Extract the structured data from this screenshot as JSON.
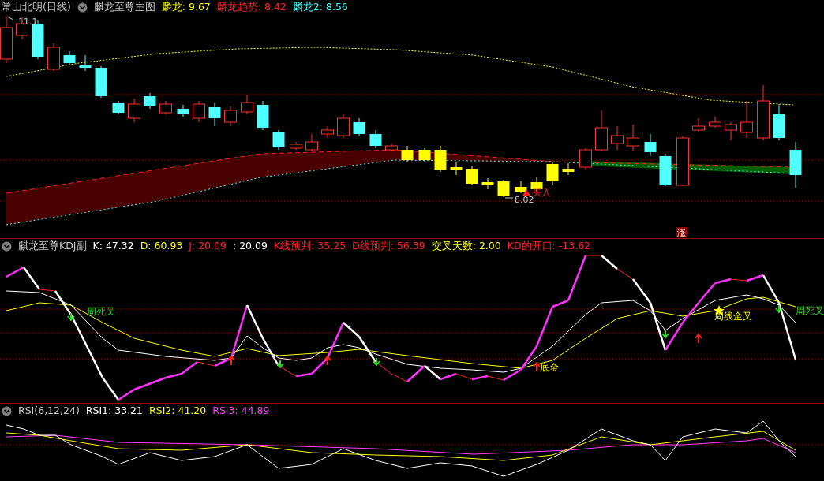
{
  "main_panel": {
    "stock_name": "常山北明(日线)",
    "indicator": "麒龙至尊主图",
    "readouts": [
      {
        "text": "麟龙: 9.67",
        "color": "#ffff00"
      },
      {
        "text": "麟龙趋势: 8.42",
        "color": "#ff2020"
      },
      {
        "text": "麟龙2: 8.56",
        "color": "#40ffff"
      }
    ],
    "high_label": "11.1",
    "low_label": "8.02",
    "buy_label": "买入",
    "limit_badge": "涨"
  },
  "kdj_panel": {
    "indicator": "麒龙至尊KDJ副",
    "readouts": [
      {
        "text": "K: 47.32",
        "color": "#ffffff"
      },
      {
        "text": "D: 60.93",
        "color": "#ffff00"
      },
      {
        "text": "J: 20.09",
        "color": "#ff2020"
      },
      {
        "text": ": 20.09",
        "color": "#ffffff"
      },
      {
        "text": "K线预判: 35.25",
        "color": "#ff2020"
      },
      {
        "text": "D线预判: 56.39",
        "color": "#ff2020"
      },
      {
        "text": "交叉天数: 2.00",
        "color": "#ffff00"
      },
      {
        "text": "KD的开口: -13.62",
        "color": "#ff2020"
      }
    ],
    "signals": [
      {
        "text": "周死叉",
        "kind": "death"
      },
      {
        "text": "底金",
        "kind": "golden"
      },
      {
        "text": "周线金叉",
        "kind": "golden"
      },
      {
        "text": "周死叉",
        "kind": "death"
      }
    ]
  },
  "rsi_panel": {
    "indicator": "RSI(6,12,24)",
    "readouts": [
      {
        "text": "RSI1: 33.21",
        "color": "#ffffff"
      },
      {
        "text": "RSI2: 41.20",
        "color": "#ffff00"
      },
      {
        "text": "RSI3: 44.89",
        "color": "#ff40ff"
      }
    ]
  }
}
